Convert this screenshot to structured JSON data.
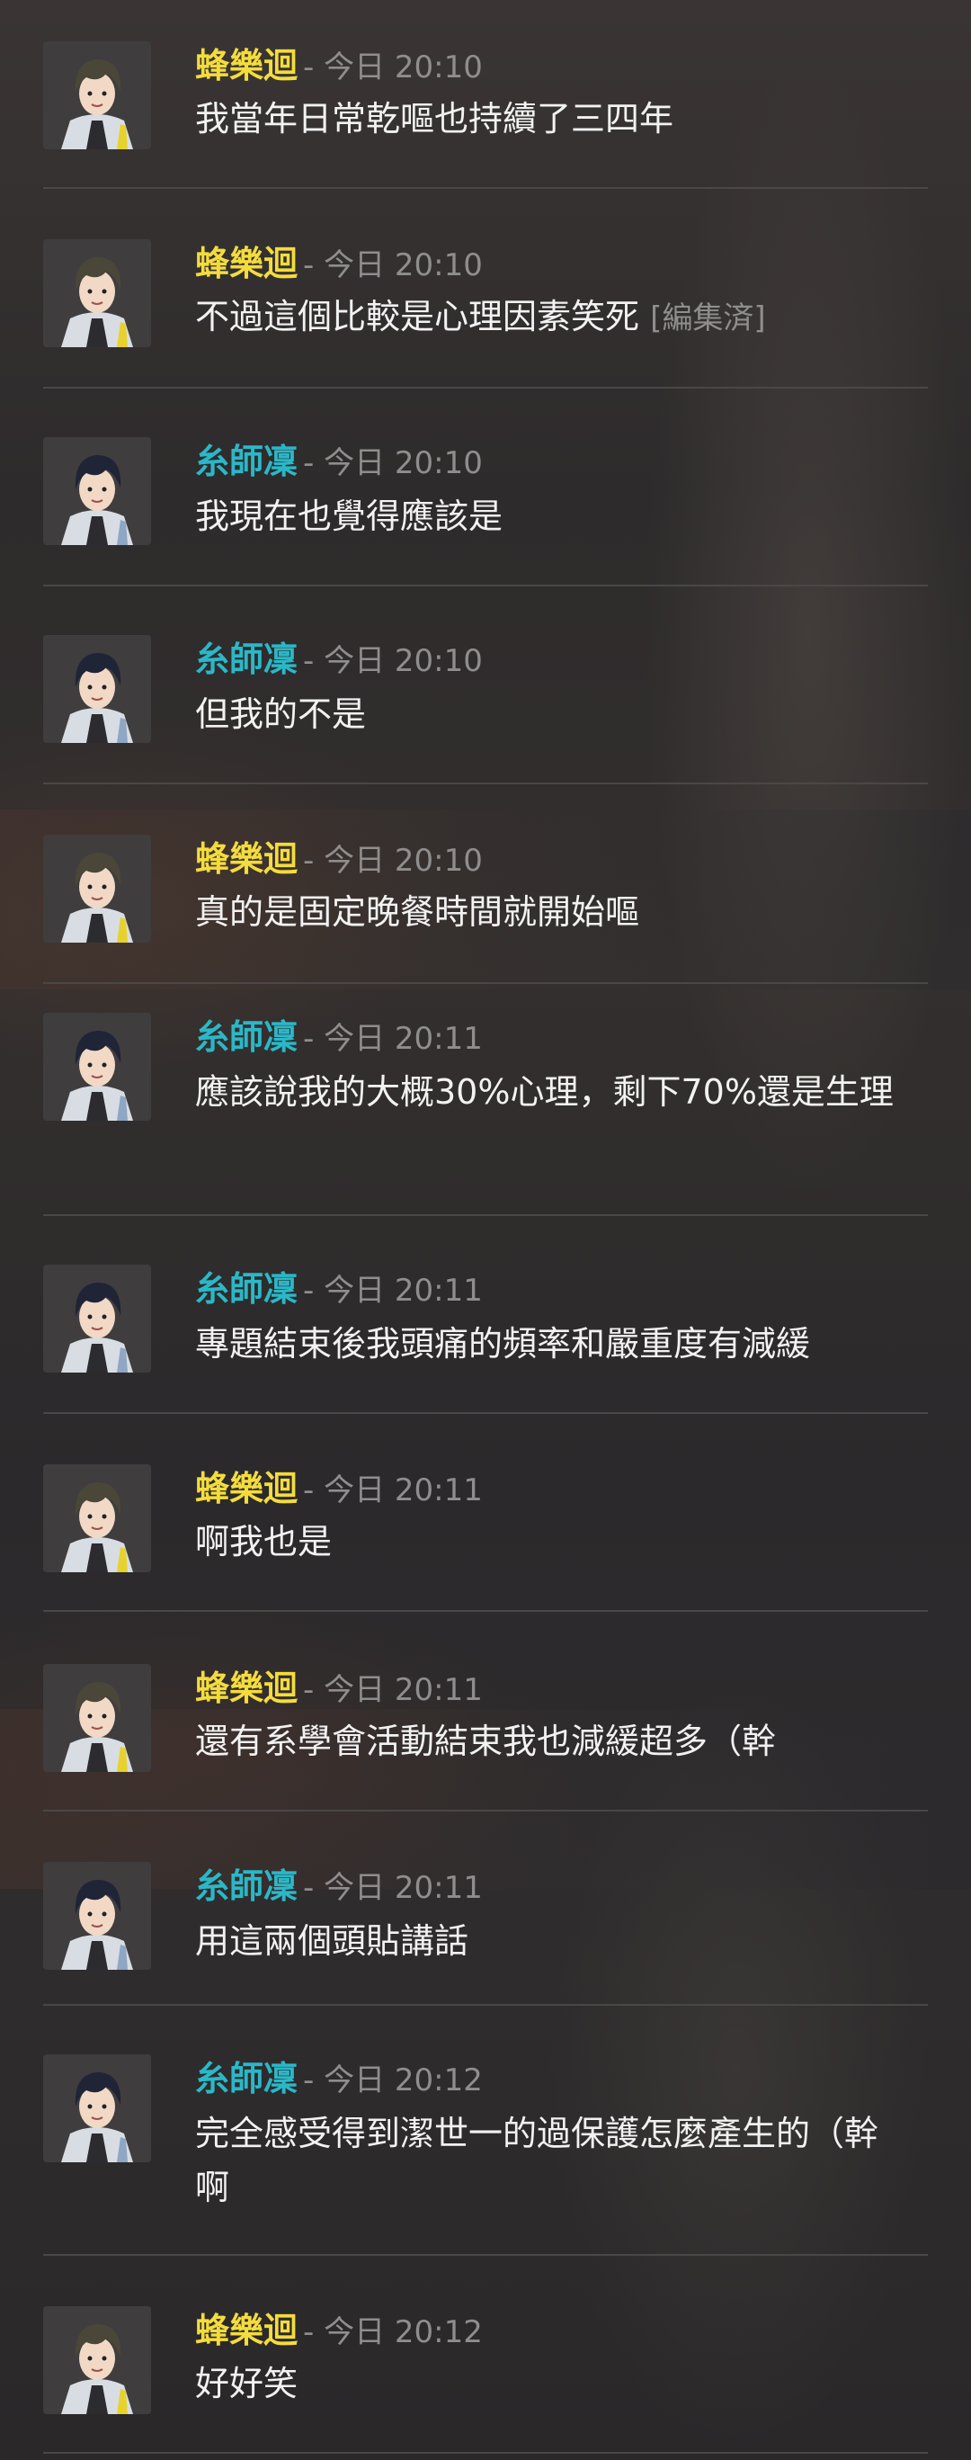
{
  "users": {
    "hou": {
      "name": "蜂樂迴",
      "color": "#f3dc3d"
    },
    "rin": {
      "name": "糸師凜",
      "color": "#2ab8c8"
    }
  },
  "messages": [
    {
      "user": "蜂樂迴",
      "meta": "- 今日 20:10",
      "text": "我當年日常乾嘔也持續了三四年",
      "edited": ""
    },
    {
      "user": "蜂樂迴",
      "meta": "- 今日 20:10",
      "text": "不過這個比較是心理因素笑死",
      "edited": "[編集済]"
    },
    {
      "user": "糸師凜",
      "meta": "- 今日 20:10",
      "text": "我現在也覺得應該是",
      "edited": ""
    },
    {
      "user": "糸師凜",
      "meta": "- 今日 20:10",
      "text": "但我的不是",
      "edited": ""
    },
    {
      "user": "蜂樂迴",
      "meta": "- 今日 20:10",
      "text": "真的是固定晚餐時間就開始嘔",
      "edited": ""
    },
    {
      "user": "糸師凜",
      "meta": "- 今日 20:11",
      "text": "應該說我的大概30%心理，剩下70%還是生理",
      "edited": ""
    },
    {
      "user": "糸師凜",
      "meta": "- 今日 20:11",
      "text": "專題結束後我頭痛的頻率和嚴重度有減緩",
      "edited": ""
    },
    {
      "user": "蜂樂迴",
      "meta": "- 今日 20:11",
      "text": "啊我也是",
      "edited": ""
    },
    {
      "user": "蜂樂迴",
      "meta": "- 今日 20:11",
      "text": "還有系學會活動結束我也減緩超多（幹",
      "edited": ""
    },
    {
      "user": "糸師凜",
      "meta": "- 今日 20:11",
      "text": "用這兩個頭貼講話",
      "edited": ""
    },
    {
      "user": "糸師凜",
      "meta": "- 今日 20:12",
      "text": "完全感受得到潔世一的過保護怎麼產生的（幹啊",
      "edited": ""
    },
    {
      "user": "蜂樂迴",
      "meta": "- 今日 20:12",
      "text": "好好笑",
      "edited": ""
    }
  ]
}
